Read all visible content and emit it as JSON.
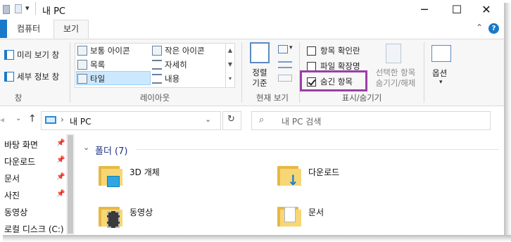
{
  "titlebar": {
    "title": "내 PC",
    "minimize_glyph": "─",
    "maximize_glyph": "☐",
    "close_glyph": "✕",
    "qat_glyph": "▾"
  },
  "menu": {
    "tabs": [
      "컴퓨터",
      "보기"
    ],
    "expand_glyph": "⌃",
    "help_glyph": "?"
  },
  "ribbon": {
    "pane": {
      "preview_label": "미리 보기 창",
      "details_label": "세부 정보 창",
      "group_label": "창"
    },
    "layout": {
      "items": [
        "보통 아이콘",
        "작은 아이콘",
        "목록",
        "자세히",
        "타일",
        "내용"
      ],
      "selected": "타일",
      "group_label": "레이아웃"
    },
    "current_view": {
      "sort_label": "정렬\n기준",
      "sort_line1": "정렬",
      "sort_line2": "기준",
      "group_label": "현재 보기"
    },
    "show_hide": {
      "item_checkboxes": "항목 확인란",
      "file_extensions": "파일 확장명",
      "hidden_items": "숨긴 항목",
      "hidden_items_checked": true,
      "item_checkboxes_checked": false,
      "file_extensions_checked": false,
      "hide_selected_line1": "선택한 항목",
      "hide_selected_line2": "숨기기/해제",
      "group_label": "표시/숨기기"
    },
    "options": {
      "label": "옵션",
      "dropdown_glyph": "▾"
    },
    "highlight_color": "#9b3ea6"
  },
  "address": {
    "location": "내 PC",
    "separator": "›",
    "search_placeholder": "내 PC 검색"
  },
  "nav": {
    "items": [
      "바탕 화면",
      "다운로드",
      "문서",
      "사진",
      "동영상",
      "로컬 디스크 (C:)"
    ],
    "pinned": [
      true,
      true,
      true,
      true,
      false,
      false
    ]
  },
  "content": {
    "section_title": "폴더 (7)",
    "folders": [
      "3D 개체",
      "다운로드",
      "동영상",
      "문서"
    ]
  }
}
